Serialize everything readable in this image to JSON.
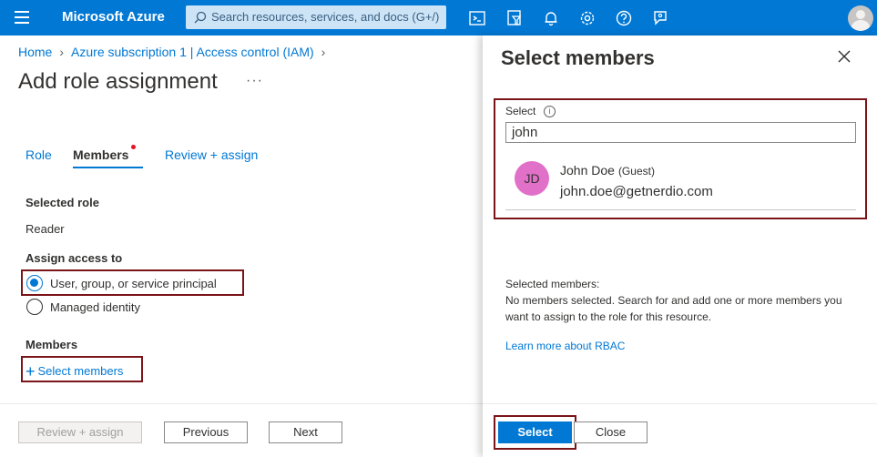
{
  "topbar": {
    "brand": "Microsoft Azure",
    "search_placeholder": "Search resources, services, and docs (G+/)",
    "icons": [
      "cloud-shell-icon",
      "directory-filter-icon",
      "notifications-icon",
      "settings-icon",
      "help-icon",
      "feedback-icon",
      "account-avatar"
    ]
  },
  "breadcrumb": {
    "items": [
      "Home",
      "Azure subscription 1 | Access control (IAM)"
    ]
  },
  "page": {
    "title": "Add role assignment",
    "more": "···"
  },
  "tabs": [
    {
      "label": "Role",
      "active": false
    },
    {
      "label": "Members",
      "active": true
    },
    {
      "label": "Review + assign",
      "active": false
    }
  ],
  "form": {
    "selected_role_label": "Selected role",
    "selected_role_value": "Reader",
    "assign_access_label": "Assign access to",
    "options": [
      {
        "label": "User, group, or service principal",
        "checked": true
      },
      {
        "label": "Managed identity",
        "checked": false
      }
    ],
    "members_label": "Members",
    "select_members_link": "Select members"
  },
  "footer": {
    "review_assign": "Review + assign",
    "previous": "Previous",
    "next": "Next"
  },
  "panel": {
    "title": "Select members",
    "select_label": "Select",
    "search_value": "john",
    "result": {
      "initials": "JD",
      "name": "John Doe",
      "tag": "(Guest)",
      "email": "john.doe@getnerdio.com"
    },
    "selected_members_heading": "Selected members:",
    "selected_members_empty": "No members selected. Search for and add one or more members you want to assign to the role for this resource.",
    "learn_more": "Learn more about RBAC",
    "select_button": "Select",
    "close_button": "Close"
  },
  "colors": {
    "accent": "#0078d4",
    "highlight_border": "#7a1419",
    "avatar": "#e170c8"
  }
}
